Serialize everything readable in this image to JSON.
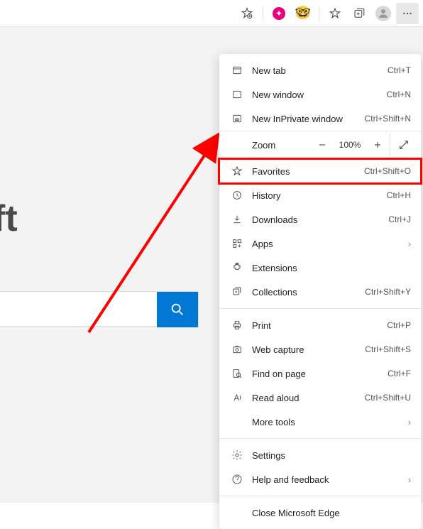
{
  "toolbar": {
    "favorites_tooltip": "Add to favorites"
  },
  "page": {
    "brand_fragment": "ft"
  },
  "menu": {
    "new_tab": {
      "label": "New tab",
      "shortcut": "Ctrl+T"
    },
    "new_window": {
      "label": "New window",
      "shortcut": "Ctrl+N"
    },
    "new_inprivate": {
      "label": "New InPrivate window",
      "shortcut": "Ctrl+Shift+N"
    },
    "zoom": {
      "label": "Zoom",
      "value": "100%"
    },
    "favorites": {
      "label": "Favorites",
      "shortcut": "Ctrl+Shift+O"
    },
    "history": {
      "label": "History",
      "shortcut": "Ctrl+H"
    },
    "downloads": {
      "label": "Downloads",
      "shortcut": "Ctrl+J"
    },
    "apps": {
      "label": "Apps"
    },
    "extensions": {
      "label": "Extensions"
    },
    "collections": {
      "label": "Collections",
      "shortcut": "Ctrl+Shift+Y"
    },
    "print": {
      "label": "Print",
      "shortcut": "Ctrl+P"
    },
    "web_capture": {
      "label": "Web capture",
      "shortcut": "Ctrl+Shift+S"
    },
    "find": {
      "label": "Find on page",
      "shortcut": "Ctrl+F"
    },
    "read_aloud": {
      "label": "Read aloud",
      "shortcut": "Ctrl+Shift+U"
    },
    "more_tools": {
      "label": "More tools"
    },
    "settings": {
      "label": "Settings"
    },
    "help": {
      "label": "Help and feedback"
    },
    "close": {
      "label": "Close Microsoft Edge"
    }
  }
}
